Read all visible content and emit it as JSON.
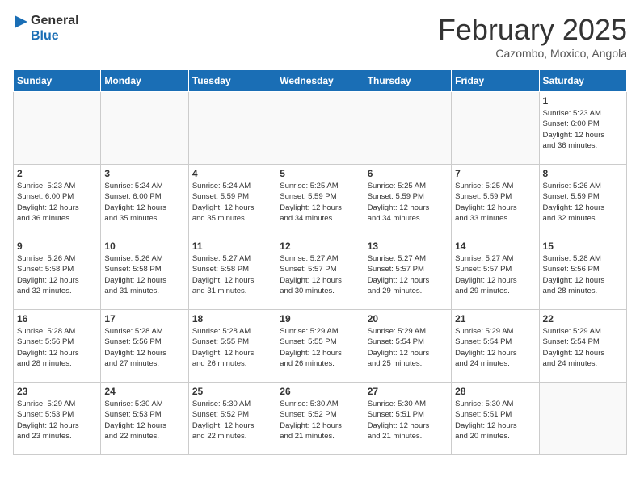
{
  "header": {
    "logo_line1": "General",
    "logo_line2": "Blue",
    "title": "February 2025",
    "subtitle": "Cazombo, Moxico, Angola"
  },
  "weekdays": [
    "Sunday",
    "Monday",
    "Tuesday",
    "Wednesday",
    "Thursday",
    "Friday",
    "Saturday"
  ],
  "weeks": [
    [
      {
        "day": "",
        "info": ""
      },
      {
        "day": "",
        "info": ""
      },
      {
        "day": "",
        "info": ""
      },
      {
        "day": "",
        "info": ""
      },
      {
        "day": "",
        "info": ""
      },
      {
        "day": "",
        "info": ""
      },
      {
        "day": "1",
        "info": "Sunrise: 5:23 AM\nSunset: 6:00 PM\nDaylight: 12 hours\nand 36 minutes."
      }
    ],
    [
      {
        "day": "2",
        "info": "Sunrise: 5:23 AM\nSunset: 6:00 PM\nDaylight: 12 hours\nand 36 minutes."
      },
      {
        "day": "3",
        "info": "Sunrise: 5:24 AM\nSunset: 6:00 PM\nDaylight: 12 hours\nand 35 minutes."
      },
      {
        "day": "4",
        "info": "Sunrise: 5:24 AM\nSunset: 5:59 PM\nDaylight: 12 hours\nand 35 minutes."
      },
      {
        "day": "5",
        "info": "Sunrise: 5:25 AM\nSunset: 5:59 PM\nDaylight: 12 hours\nand 34 minutes."
      },
      {
        "day": "6",
        "info": "Sunrise: 5:25 AM\nSunset: 5:59 PM\nDaylight: 12 hours\nand 34 minutes."
      },
      {
        "day": "7",
        "info": "Sunrise: 5:25 AM\nSunset: 5:59 PM\nDaylight: 12 hours\nand 33 minutes."
      },
      {
        "day": "8",
        "info": "Sunrise: 5:26 AM\nSunset: 5:59 PM\nDaylight: 12 hours\nand 32 minutes."
      }
    ],
    [
      {
        "day": "9",
        "info": "Sunrise: 5:26 AM\nSunset: 5:58 PM\nDaylight: 12 hours\nand 32 minutes."
      },
      {
        "day": "10",
        "info": "Sunrise: 5:26 AM\nSunset: 5:58 PM\nDaylight: 12 hours\nand 31 minutes."
      },
      {
        "day": "11",
        "info": "Sunrise: 5:27 AM\nSunset: 5:58 PM\nDaylight: 12 hours\nand 31 minutes."
      },
      {
        "day": "12",
        "info": "Sunrise: 5:27 AM\nSunset: 5:57 PM\nDaylight: 12 hours\nand 30 minutes."
      },
      {
        "day": "13",
        "info": "Sunrise: 5:27 AM\nSunset: 5:57 PM\nDaylight: 12 hours\nand 29 minutes."
      },
      {
        "day": "14",
        "info": "Sunrise: 5:27 AM\nSunset: 5:57 PM\nDaylight: 12 hours\nand 29 minutes."
      },
      {
        "day": "15",
        "info": "Sunrise: 5:28 AM\nSunset: 5:56 PM\nDaylight: 12 hours\nand 28 minutes."
      }
    ],
    [
      {
        "day": "16",
        "info": "Sunrise: 5:28 AM\nSunset: 5:56 PM\nDaylight: 12 hours\nand 28 minutes."
      },
      {
        "day": "17",
        "info": "Sunrise: 5:28 AM\nSunset: 5:56 PM\nDaylight: 12 hours\nand 27 minutes."
      },
      {
        "day": "18",
        "info": "Sunrise: 5:28 AM\nSunset: 5:55 PM\nDaylight: 12 hours\nand 26 minutes."
      },
      {
        "day": "19",
        "info": "Sunrise: 5:29 AM\nSunset: 5:55 PM\nDaylight: 12 hours\nand 26 minutes."
      },
      {
        "day": "20",
        "info": "Sunrise: 5:29 AM\nSunset: 5:54 PM\nDaylight: 12 hours\nand 25 minutes."
      },
      {
        "day": "21",
        "info": "Sunrise: 5:29 AM\nSunset: 5:54 PM\nDaylight: 12 hours\nand 24 minutes."
      },
      {
        "day": "22",
        "info": "Sunrise: 5:29 AM\nSunset: 5:54 PM\nDaylight: 12 hours\nand 24 minutes."
      }
    ],
    [
      {
        "day": "23",
        "info": "Sunrise: 5:29 AM\nSunset: 5:53 PM\nDaylight: 12 hours\nand 23 minutes."
      },
      {
        "day": "24",
        "info": "Sunrise: 5:30 AM\nSunset: 5:53 PM\nDaylight: 12 hours\nand 22 minutes."
      },
      {
        "day": "25",
        "info": "Sunrise: 5:30 AM\nSunset: 5:52 PM\nDaylight: 12 hours\nand 22 minutes."
      },
      {
        "day": "26",
        "info": "Sunrise: 5:30 AM\nSunset: 5:52 PM\nDaylight: 12 hours\nand 21 minutes."
      },
      {
        "day": "27",
        "info": "Sunrise: 5:30 AM\nSunset: 5:51 PM\nDaylight: 12 hours\nand 21 minutes."
      },
      {
        "day": "28",
        "info": "Sunrise: 5:30 AM\nSunset: 5:51 PM\nDaylight: 12 hours\nand 20 minutes."
      },
      {
        "day": "",
        "info": ""
      }
    ]
  ]
}
